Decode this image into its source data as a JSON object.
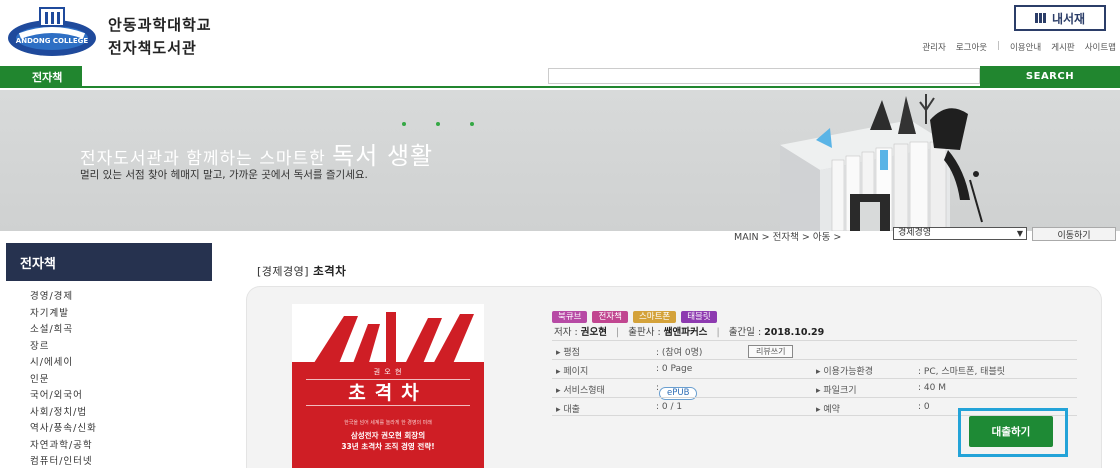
{
  "header": {
    "university_name": "안동과학대학교",
    "library_name": "전자책도서관",
    "logo_text": "ANDONG COLLEGE",
    "my_shelf_label": "내서재",
    "top_links": [
      "관리자",
      "로그아웃",
      "|",
      "이용안내",
      "게시판",
      "사이트맵"
    ]
  },
  "nav": {
    "tab_label": "전자책",
    "search_value": "",
    "search_button": "SEARCH"
  },
  "banner": {
    "title_part1": "전자도서관과 함께하는 스마트한 ",
    "title_part2": "독서 생활",
    "subtitle": "멀리 있는 서점 찾아 헤매지 말고, 가까운 곳에서 독서를 즐기세요."
  },
  "breadcrumb": {
    "path": "MAIN > 전자책 > 아동 >",
    "select_value": "경제경영",
    "go_button": "이동하기"
  },
  "sidebar": {
    "heading": "전자책",
    "items": [
      "경영/경제",
      "자기계발",
      "소설/희곡",
      "장르",
      "시/에세이",
      "인문",
      "국어/외국어",
      "사회/정치/법",
      "역사/풍속/신화",
      "자연과학/공학",
      "컴퓨터/인터넷"
    ]
  },
  "content": {
    "category": "[경제경영]",
    "book_title": "초격차"
  },
  "cover": {
    "author_line": "권 오 현",
    "title": "초격차",
    "tag_line1": "삼성전자 권오현 회장의",
    "tag_line2": "33년 초격차 조직 경영 전략!",
    "fine_print": "한국을 넘어 세계를 놀라게 한 경영의 미래"
  },
  "book": {
    "badges": [
      "북큐브",
      "전자책",
      "스마트폰",
      "태블릿"
    ],
    "author_label": "저자",
    "author": "권오현",
    "publisher_label": "출판사",
    "publisher": "쌤앤파커스",
    "pubdate_label": "출간일",
    "pubdate": "2018.10.29",
    "rating_label": "평점",
    "rating_value": "(참여 0명)",
    "review_button": "리뷰쓰기",
    "pages_label": "페이지",
    "pages_value": ": 0 Page",
    "env_label": "이용가능환경",
    "env_value": ": PC, 스마트폰, 태블릿",
    "service_label": "서비스형태",
    "service_value": "ePUB",
    "filesize_label": "파일크기",
    "filesize_value": ": 40 M",
    "loan_label": "대출",
    "loan_value": ": 0 / 1",
    "reserve_label": "예약",
    "reserve_value": ": 0",
    "borrow_button": "대출하기"
  },
  "colors": {
    "green": "#21862f",
    "navy": "#26324f",
    "highlight": "#23a3d8",
    "cover_red": "#cf1e25"
  }
}
